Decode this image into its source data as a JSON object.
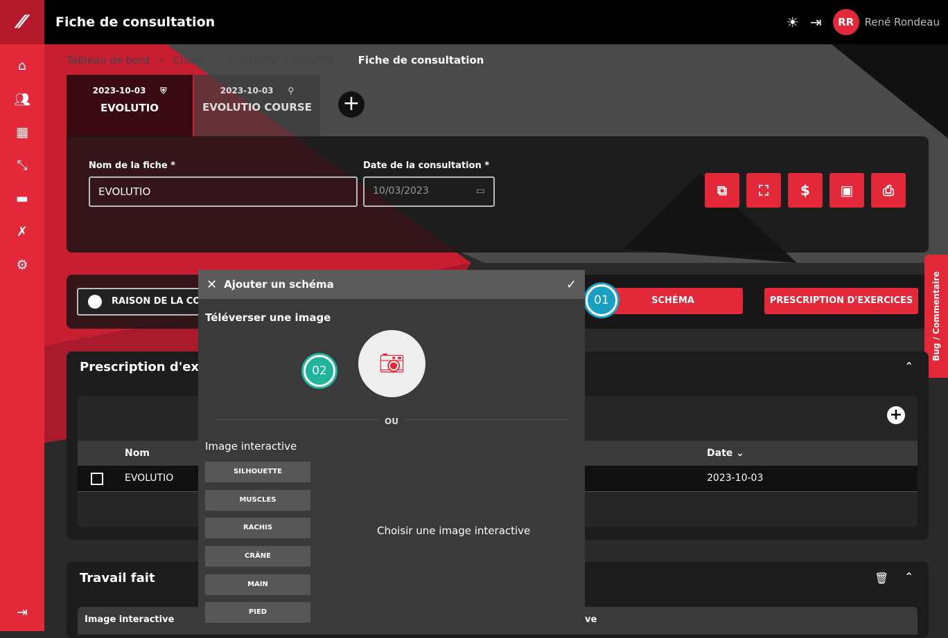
{
  "app": {
    "title": "Fiche de consultation",
    "user_initials": "RR",
    "user_name": "René Rondeau"
  },
  "colors": {
    "accent": "#e3283a",
    "badge": "#1a9fc4"
  },
  "sidebar": {
    "items": [
      {
        "icon": "home-icon"
      },
      {
        "icon": "users-icon"
      },
      {
        "icon": "calendar-icon"
      },
      {
        "icon": "expand-icon"
      },
      {
        "icon": "message-icon"
      },
      {
        "icon": "tools-icon"
      },
      {
        "icon": "settings-icon"
      },
      {
        "icon": "collapse-icon"
      }
    ]
  },
  "breadcrumb": [
    "Tableau de bord",
    "Client",
    "EVOLUTIO EVOLUTIO",
    "Fiche de consultation"
  ],
  "tabs": [
    {
      "date": "2023-10-03",
      "name": "EVOLUTIO",
      "icon": "shield-plus-icon"
    },
    {
      "date": "2023-10-03",
      "name": "EVOLUTIO COURSE",
      "icon": "running-icon"
    }
  ],
  "form": {
    "name_label": "Nom de la fiche *",
    "name_value": "EVOLUTIO",
    "date_label": "Date de la consultation *",
    "date_value": "10/03/2023"
  },
  "section_buttons": {
    "raison": "RAISON DE LA CON",
    "schema": "SCHÉMA",
    "prescription": "PRESCRIPTION D'EXERCICES"
  },
  "badges": {
    "one": "01",
    "two": "02"
  },
  "bug_tab": "Bug / Commentaire",
  "prescription": {
    "title": "Prescription d'exer",
    "col_nom": "Nom",
    "col_date": "Date",
    "row": {
      "nom": "EVOLUTIO",
      "date": "2023-10-03"
    }
  },
  "travail": {
    "title": "Travail fait",
    "col_left": "Image interactive",
    "col_right": "ve"
  },
  "modal": {
    "title": "Ajouter un schéma",
    "upload_label": "Téléverser une image",
    "or": "OU",
    "interactive_label": "Image interactive",
    "options": [
      "SILHOUETTE",
      "MUSCLES",
      "RACHIS",
      "CRÂNE",
      "MAIN",
      "PIED"
    ],
    "placeholder": "Choisir une image interactive"
  }
}
